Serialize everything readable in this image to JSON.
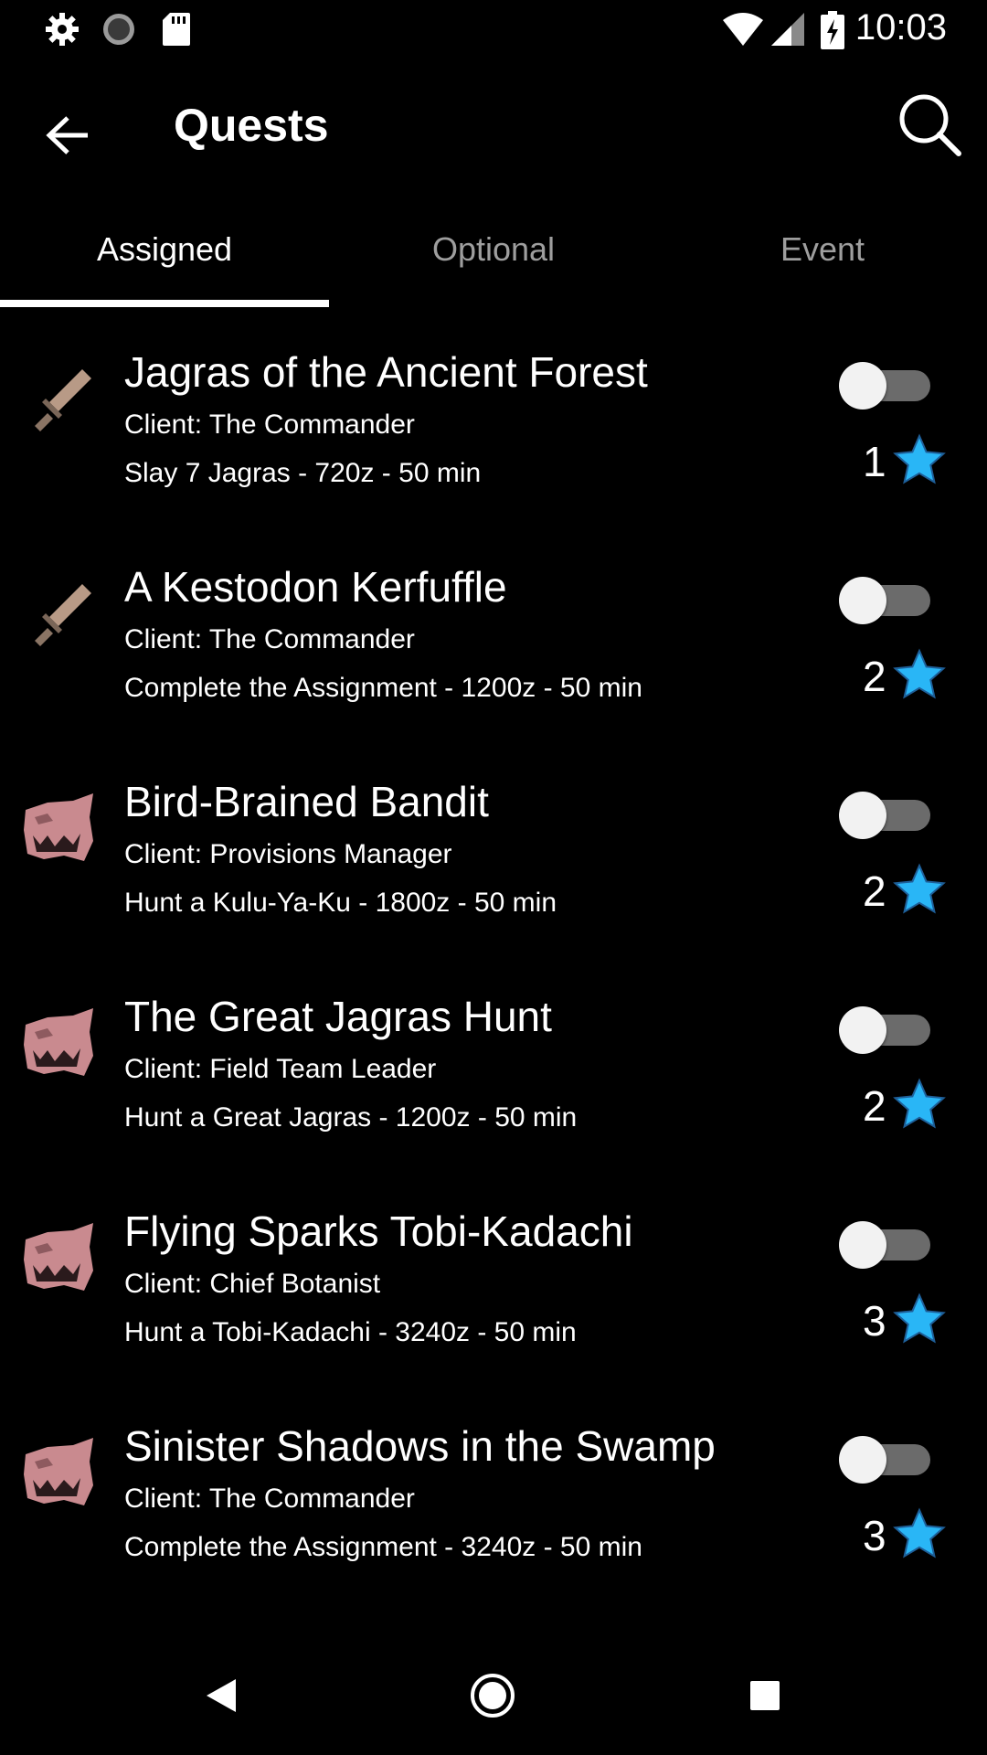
{
  "status_bar": {
    "time": "10:03",
    "left_icons": [
      "gear-icon",
      "sync-icon",
      "sd-card-icon"
    ],
    "right_icons": [
      "wifi-icon",
      "signal-icon",
      "battery-charging-icon"
    ]
  },
  "app_bar": {
    "title": "Quests",
    "back_icon": "arrow-left-icon",
    "search_icon": "search-icon"
  },
  "tabs": [
    {
      "label": "Assigned",
      "active": true
    },
    {
      "label": "Optional",
      "active": false
    },
    {
      "label": "Event",
      "active": false
    }
  ],
  "quests": [
    {
      "name": "Jagras of the Ancient Forest",
      "client": "Client: The Commander",
      "detail": "Slay 7 Jagras - 720z - 50 min",
      "rank": "1",
      "icon": "sword-icon",
      "enabled": false
    },
    {
      "name": "A Kestodon Kerfuffle",
      "client": "Client: The Commander",
      "detail": "Complete the Assignment - 1200z - 50 min",
      "rank": "2",
      "icon": "sword-icon",
      "enabled": false
    },
    {
      "name": "Bird-Brained Bandit",
      "client": "Client: Provisions Manager",
      "detail": "Hunt a Kulu-Ya-Ku - 1800z - 50 min",
      "rank": "2",
      "icon": "monster-icon",
      "enabled": false
    },
    {
      "name": "The Great Jagras Hunt",
      "client": "Client: Field Team Leader",
      "detail": "Hunt a Great Jagras - 1200z - 50 min",
      "rank": "2",
      "icon": "monster-icon",
      "enabled": false
    },
    {
      "name": "Flying Sparks Tobi-Kadachi",
      "client": "Client: Chief Botanist",
      "detail": "Hunt a Tobi-Kadachi - 3240z - 50 min",
      "rank": "3",
      "icon": "monster-icon",
      "enabled": false
    },
    {
      "name": "Sinister Shadows in the Swamp",
      "client": "Client: The Commander",
      "detail": "Complete the Assignment - 3240z - 50 min",
      "rank": "3",
      "icon": "monster-icon",
      "enabled": false
    }
  ],
  "nav_bar": {
    "back_icon": "nav-back-icon",
    "home_icon": "nav-home-icon",
    "recents_icon": "nav-recents-icon"
  },
  "colors": {
    "background": "#000000",
    "text": "#ffffff",
    "tab_inactive": "#9e9e9e",
    "star": "#29b6f6",
    "toggle_track": "#6b6b6b",
    "toggle_thumb": "#f2f2f2"
  }
}
